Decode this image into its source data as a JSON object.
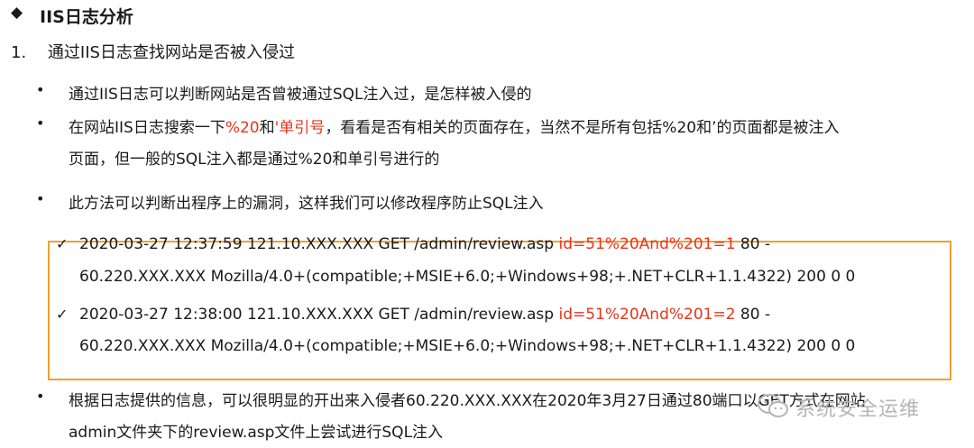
{
  "header": {
    "diamond": "◆",
    "title": "IIS日志分析"
  },
  "section": {
    "number": "1.",
    "label": "通过IIS日志查找网站是否被入侵过"
  },
  "bullets": {
    "symbol": "•",
    "b1": "通过IIS日志可以判断网站是否曾被通过SQL注入过，是怎样被入侵的",
    "b2_pre": "在网站IIS日志搜索一下",
    "b2_red1": "%20",
    "b2_mid": "和",
    "b2_red2": "'单引号",
    "b2_post": "，看看是否有相关的页面存在，当然不是所有包括%20和’的页面都是被注入",
    "b2_line2": "页面，但一般的SQL注入都是通过%20和单引号进行的",
    "b3": "此方法可以判断出程序上的漏洞，这样我们可以修改程序防止SQL注入",
    "b4_line1": "根据日志提供的信息，可以很明显的开出来入侵者60.220.XXX.XXX在2020年3月27日通过80端口以GET方式在网站",
    "b4_line2": "admin文件夹下的review.asp文件上尝试进行SQL注入"
  },
  "logs": {
    "check": "✓",
    "entries": [
      {
        "pre": "2020-03-27 12:37:59 121.10.XXX.XXX GET /admin/review.asp ",
        "red": "id=51%20And%201=1",
        "post": " 80 -",
        "line2": "60.220.XXX.XXX Mozilla/4.0+(compatible;+MSIE+6.0;+Windows+98;+.NET+CLR+1.1.4322) 200 0 0"
      },
      {
        "pre": "2020-03-27 12:38:00 121.10.XXX.XXX GET /admin/review.asp ",
        "red": "id=51%20And%201=2",
        "post": " 80 -",
        "line2": "60.220.XXX.XXX Mozilla/4.0+(compatible;+MSIE+6.0;+Windows+98;+.NET+CLR+1.1.4322) 200 0 0"
      }
    ]
  },
  "watermark": {
    "text": "系统安全运维",
    "icon": "wechat-icon"
  },
  "colors": {
    "highlight": "#e8341c",
    "box_border": "#f0a030"
  }
}
